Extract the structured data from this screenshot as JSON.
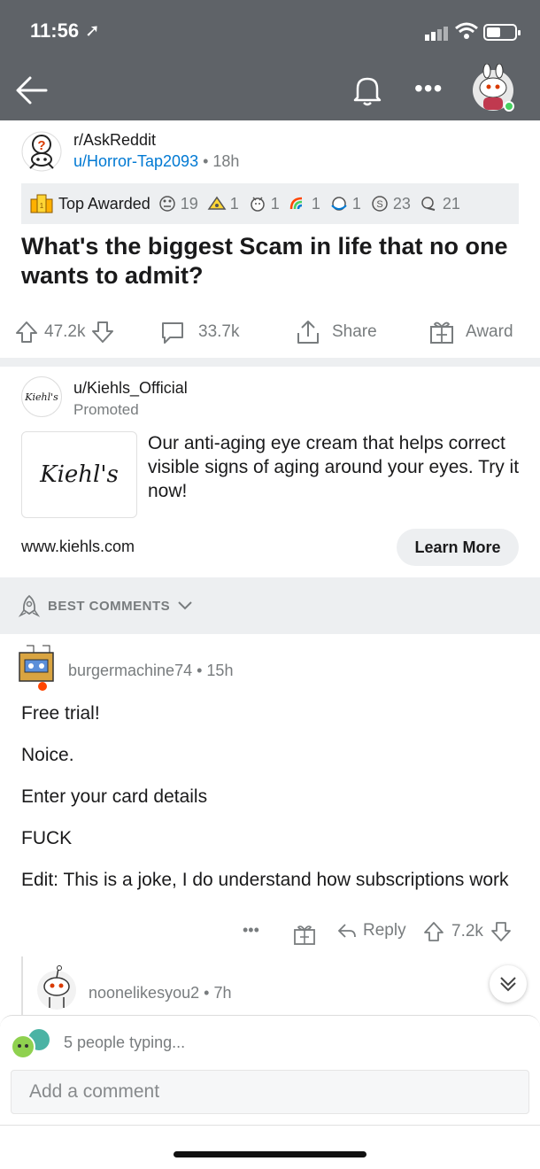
{
  "status_bar": {
    "time": "11:56",
    "location_arrow": "location-arrow-icon"
  },
  "nav": {
    "back_icon": "back-arrow-icon",
    "bell_icon": "bell-icon",
    "more_label": "•••"
  },
  "post": {
    "subreddit": "r/AskReddit",
    "author": "u/Horror-Tap2093",
    "age": "18h",
    "awards_header": "Top Awarded",
    "awards": [
      {
        "icon": "rolling-eyes-icon",
        "count": "19"
      },
      {
        "icon": "hat-award-icon",
        "count": "1"
      },
      {
        "icon": "wholesome-seal-icon",
        "count": "1"
      },
      {
        "icon": "rainbow-icon",
        "count": "1"
      },
      {
        "icon": "hugz-icon",
        "count": "1"
      },
      {
        "icon": "silver-icon",
        "count": "23"
      },
      {
        "icon": "helpful-icon",
        "count": "21"
      }
    ],
    "title": "What's the biggest Scam in life that no one wants to admit?",
    "upvotes": "47.2k",
    "comments": "33.7k",
    "share_label": "Share",
    "award_label": "Award"
  },
  "promo": {
    "user": "u/Kiehls_Official",
    "label": "Promoted",
    "brand": "Kiehl's",
    "ad_text": "Our anti-aging eye cream that helps correct visible signs of aging around your eyes. Try it now!",
    "url": "www.kiehls.com",
    "cta": "Learn More"
  },
  "sort": {
    "label": "BEST COMMENTS"
  },
  "comment": {
    "author": "burgermachine74",
    "age": "15h",
    "paragraphs": [
      "Free trial!",
      "Noice.",
      "Enter your card details",
      "FUCK",
      "Edit: This is a joke, I do understand how subscriptions work"
    ],
    "more_label": "•••",
    "reply_label": "Reply",
    "score": "7.2k"
  },
  "reply": {
    "author": "noonelikesyou2",
    "age": "7h"
  },
  "compose": {
    "typing_text": "5 people typing...",
    "placeholder": "Add a comment"
  }
}
